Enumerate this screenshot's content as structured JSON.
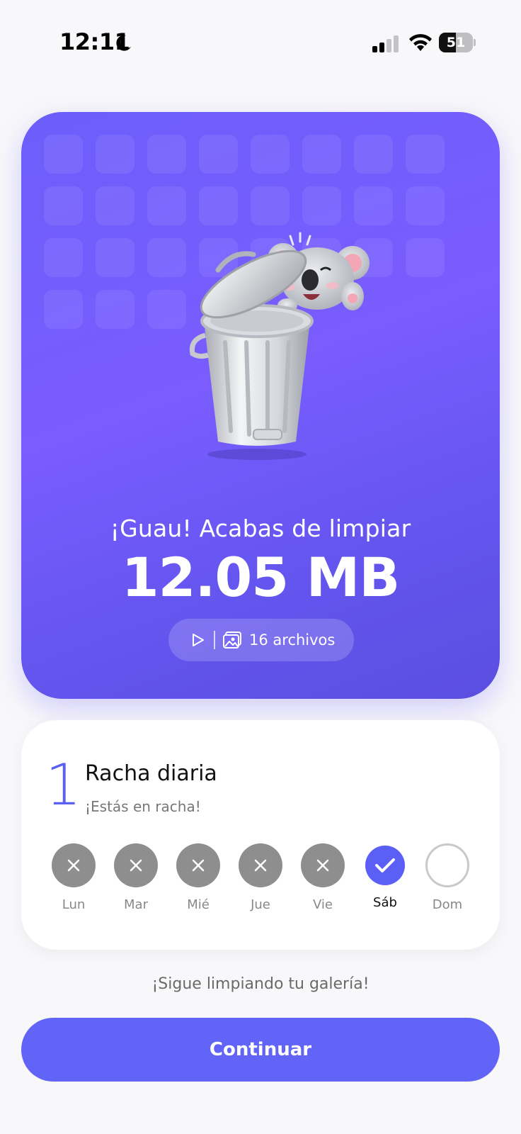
{
  "status_bar": {
    "time": "12:11",
    "battery_level": "51",
    "battery_fraction": 0.51,
    "icons": [
      "moon-icon",
      "cellular-signal-icon",
      "wifi-icon",
      "battery-icon"
    ]
  },
  "hero": {
    "subtitle": "¡Guau! Acabas de limpiar",
    "amount": "12.05 MB",
    "files_label": "16 archivos",
    "icons": [
      "play-icon",
      "gallery-icon"
    ],
    "illustration": "koala-in-trash-can"
  },
  "streak": {
    "count": "1",
    "title": "Racha diaria",
    "subtitle": "¡Estás en racha!",
    "days": [
      {
        "label": "Lun",
        "state": "missed"
      },
      {
        "label": "Mar",
        "state": "missed"
      },
      {
        "label": "Mié",
        "state": "missed"
      },
      {
        "label": "Jue",
        "state": "missed"
      },
      {
        "label": "Vie",
        "state": "missed"
      },
      {
        "label": "Sáb",
        "state": "done"
      },
      {
        "label": "Dom",
        "state": "pending"
      }
    ]
  },
  "footer": {
    "keep_text": "¡Sigue limpiando tu galería!",
    "continue_label": "Continuar"
  },
  "colors": {
    "accent": "#6164f7",
    "hero_gradient_start": "#6c5efb",
    "hero_gradient_end": "#5a4ee0",
    "missed": "#8e8e8e",
    "background": "#f8f8fa"
  }
}
